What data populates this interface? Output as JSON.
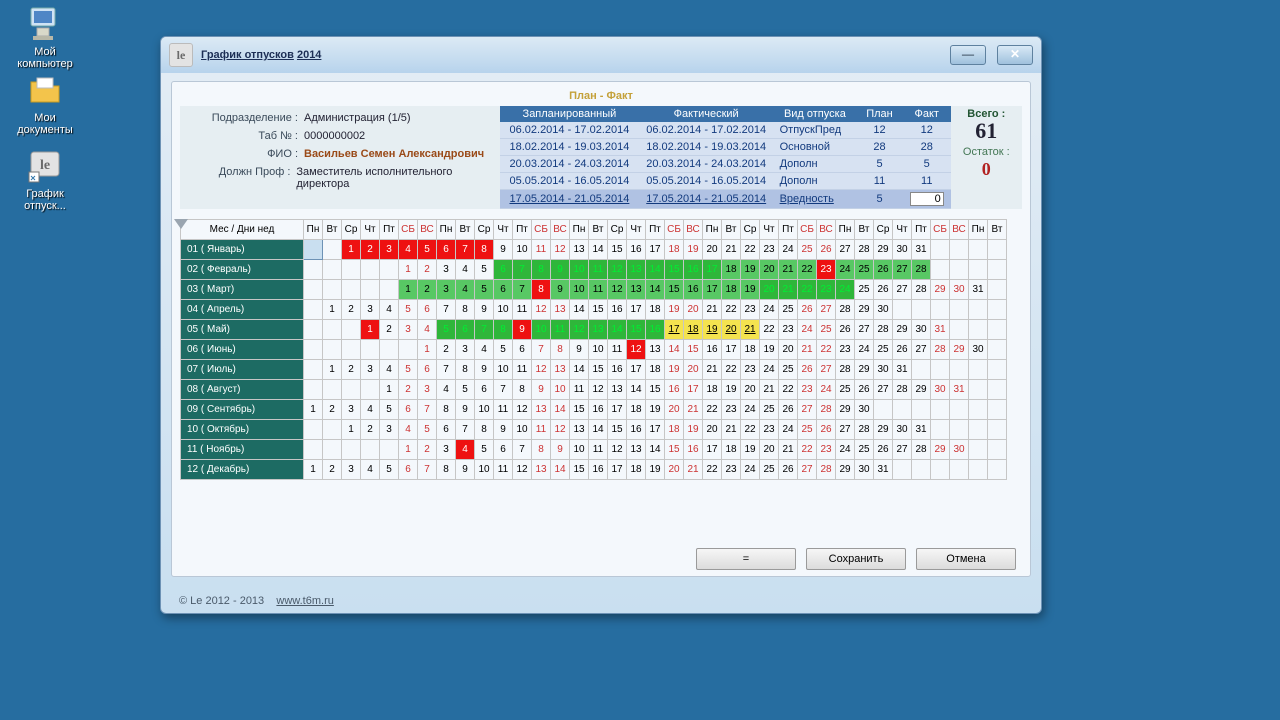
{
  "desktop": {
    "icons": [
      {
        "name": "Мой компьютер",
        "kind": "computer"
      },
      {
        "name": "Мои документы",
        "kind": "folder"
      },
      {
        "name": "График отпуск...",
        "kind": "app"
      }
    ]
  },
  "window": {
    "app_badge": "le",
    "title_prefix": "График отпусков",
    "title_year": "2014",
    "minimize": "—",
    "close": "✕"
  },
  "caption": "План - Факт",
  "employee": {
    "division_label": "Подразделение :",
    "division": "Администрация (1/5)",
    "tab_label": "Таб № :",
    "tab": "0000000002",
    "fio_label": "ФИО :",
    "fio": "Васильев Семен Александрович",
    "post_label": "Должн Проф :",
    "post": "Заместитель исполнительного директора"
  },
  "plan_headers": {
    "planned": "Запланированный",
    "actual": "Фактический",
    "kind": "Вид отпуска",
    "plan": "План",
    "fact": "Факт"
  },
  "plan_rows": [
    {
      "planned": "06.02.2014 - 17.02.2014",
      "actual": "06.02.2014 - 17.02.2014",
      "kind": "ОтпускПред",
      "plan": "12",
      "fact": "12"
    },
    {
      "planned": "18.02.2014 - 19.03.2014",
      "actual": "18.02.2014 - 19.03.2014",
      "kind": "Основной",
      "plan": "28",
      "fact": "28"
    },
    {
      "planned": "20.03.2014 - 24.03.2014",
      "actual": "20.03.2014 - 24.03.2014",
      "kind": "Дополн",
      "plan": "5",
      "fact": "5"
    },
    {
      "planned": "05.05.2014 - 16.05.2014",
      "actual": "05.05.2014 - 16.05.2014",
      "kind": "Дополн",
      "plan": "11",
      "fact": "11"
    },
    {
      "planned": "17.05.2014 - 21.05.2014",
      "actual": "17.05.2014 - 21.05.2014",
      "kind": "Вредность",
      "plan": "5",
      "fact_input": "0"
    }
  ],
  "totals": {
    "total_label": "Всего :",
    "total": "61",
    "remain_label": "Остаток :",
    "remain": "0"
  },
  "months_header": "Мес / Дни нед",
  "dow": [
    "Пн",
    "Вт",
    "Ср",
    "Чт",
    "Пт",
    "СБ",
    "ВС",
    "Пн",
    "Вт",
    "Ср",
    "Чт",
    "Пт",
    "СБ",
    "ВС",
    "Пн",
    "Вт",
    "Ср",
    "Чт",
    "Пт",
    "СБ",
    "ВС",
    "Пн",
    "Вт",
    "Ср",
    "Чт",
    "Пт",
    "СБ",
    "ВС",
    "Пн",
    "Вт",
    "Ср",
    "Чт",
    "Пт",
    "СБ",
    "ВС",
    "Пн",
    "Вт"
  ],
  "months": [
    {
      "label": "01 ( Январь)",
      "offset": 2,
      "days": 31,
      "cells": {
        "0": "start",
        "1": "hol",
        "2": "hol",
        "3": "hol",
        "4": "hol",
        "5": "hol",
        "6": "hol",
        "7": "hol",
        "8": "hol"
      }
    },
    {
      "label": "02 ( Февраль)",
      "offset": 5,
      "days": 28,
      "cells": {
        "6": "grn",
        "7": "grn",
        "8": "grn",
        "9": "grn",
        "10": "grn",
        "11": "grn",
        "12": "grn",
        "13": "grn",
        "14": "grn",
        "15": "grn",
        "16": "grn",
        "17": "grn",
        "18": "grn2",
        "19": "grn2",
        "20": "grn2",
        "21": "grn2",
        "22": "grn2",
        "23": "hol",
        "24": "grn2",
        "25": "grn2",
        "26": "grn2",
        "27": "grn2",
        "28": "grn2"
      }
    },
    {
      "label": "03 ( Март)",
      "offset": 5,
      "days": 31,
      "cells": {
        "1": "grn2",
        "2": "grn2",
        "3": "grn2",
        "4": "grn2",
        "5": "grn2",
        "6": "grn2",
        "7": "grn2",
        "8": "hol",
        "9": "grn2",
        "10": "grn2",
        "11": "grn2",
        "12": "grn2",
        "13": "grn2",
        "14": "grn2",
        "15": "grn2",
        "16": "grn2",
        "17": "grn2",
        "18": "grn2",
        "19": "grn2",
        "20": "grn",
        "21": "grn",
        "22": "grn",
        "23": "grn",
        "24": "grn"
      }
    },
    {
      "label": "04 ( Апрель)",
      "offset": 1,
      "days": 30,
      "cells": {}
    },
    {
      "label": "05 ( Май)",
      "offset": 3,
      "days": 31,
      "cells": {
        "1": "hol",
        "5": "grn",
        "6": "grn",
        "7": "grn",
        "8": "grn",
        "9": "hol",
        "10": "grn",
        "11": "grn",
        "12": "grn",
        "13": "grn",
        "14": "grn",
        "15": "grn",
        "16": "grn",
        "17": "yel",
        "18": "yel",
        "19": "yel",
        "20": "yel",
        "21": "yel"
      }
    },
    {
      "label": "06 ( Июнь)",
      "offset": 6,
      "days": 30,
      "cells": {
        "12": "hol"
      }
    },
    {
      "label": "07 ( Июль)",
      "offset": 1,
      "days": 31,
      "cells": {}
    },
    {
      "label": "08 ( Август)",
      "offset": 4,
      "days": 31,
      "cells": {}
    },
    {
      "label": "09 ( Сентябрь)",
      "offset": 0,
      "days": 30,
      "cells": {}
    },
    {
      "label": "10 ( Октябрь)",
      "offset": 2,
      "days": 31,
      "cells": {}
    },
    {
      "label": "11 ( Ноябрь)",
      "offset": 5,
      "days": 30,
      "cells": {
        "4": "hol"
      }
    },
    {
      "label": "12 ( Декабрь)",
      "offset": 0,
      "days": 31,
      "cells": {}
    }
  ],
  "buttons": {
    "eq": "=",
    "save": "Сохранить",
    "cancel": "Отмена"
  },
  "footer": {
    "copyright": "© Le 2012 - 2013",
    "link": "www.t6m.ru"
  }
}
